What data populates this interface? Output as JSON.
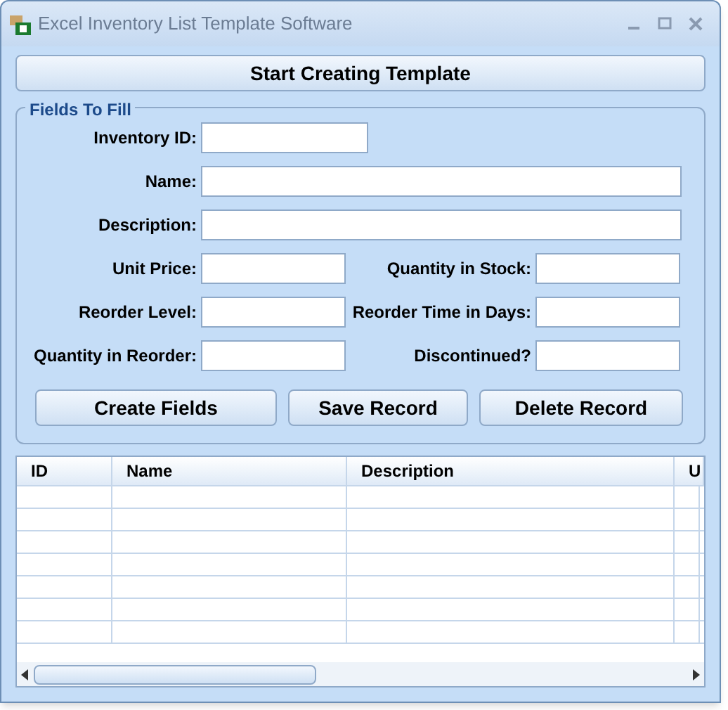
{
  "window": {
    "title": "Excel Inventory List Template Software"
  },
  "start_button": "Start Creating Template",
  "group": {
    "title": "Fields To Fill",
    "rows": [
      [
        {
          "label": "Inventory ID:",
          "kind": "short"
        }
      ],
      [
        {
          "label": "Name:",
          "kind": "wide"
        }
      ],
      [
        {
          "label": "Description:",
          "kind": "wide"
        }
      ],
      [
        {
          "label": "Unit Price:",
          "kind": "medium"
        },
        {
          "label": "Quantity in Stock:",
          "kind": "medium"
        }
      ],
      [
        {
          "label": "Reorder Level:",
          "kind": "medium"
        },
        {
          "label": "Reorder Time in Days:",
          "kind": "medium"
        }
      ],
      [
        {
          "label": "Quantity in Reorder:",
          "kind": "medium"
        },
        {
          "label": "Discontinued?",
          "kind": "medium"
        }
      ]
    ],
    "buttons": [
      "Create Fields",
      "Save Record",
      "Delete Record"
    ]
  },
  "table": {
    "columns": [
      "ID",
      "Name",
      "Description",
      "U"
    ]
  }
}
